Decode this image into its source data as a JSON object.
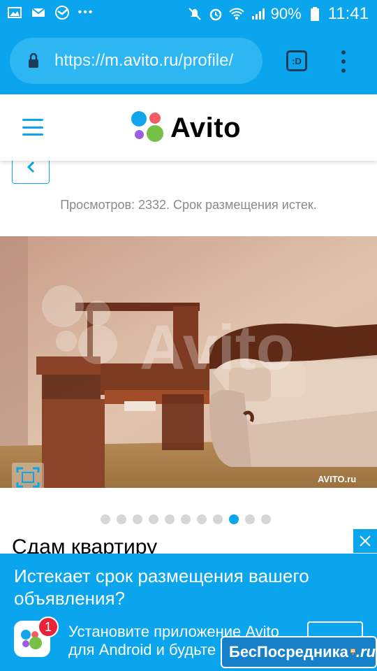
{
  "status_bar": {
    "battery": "90%",
    "time": "11:41"
  },
  "browser": {
    "url_host": "m.avito.ru",
    "url_scheme": "https://",
    "url_path": "/profile/",
    "tab_label": ":D"
  },
  "site": {
    "logo_text": "Avito",
    "brand_color": "#0aa5ec"
  },
  "listing": {
    "views_text": "Просмотров: 2332. Срок размещения истек.",
    "photo_watermark": "Avito",
    "photo_credit": "AVITO.ru",
    "gallery_total": 11,
    "gallery_active_index": 8,
    "title": "Сдам квартиру"
  },
  "banner": {
    "title": "Истекает срок размещения вашего объявления?",
    "install_line1": "Установите приложение Avito",
    "install_line2": "для Android и будьте",
    "badge_count": "1"
  },
  "watermark": {
    "text": "БесПосредника",
    "suffix": ".ru"
  }
}
